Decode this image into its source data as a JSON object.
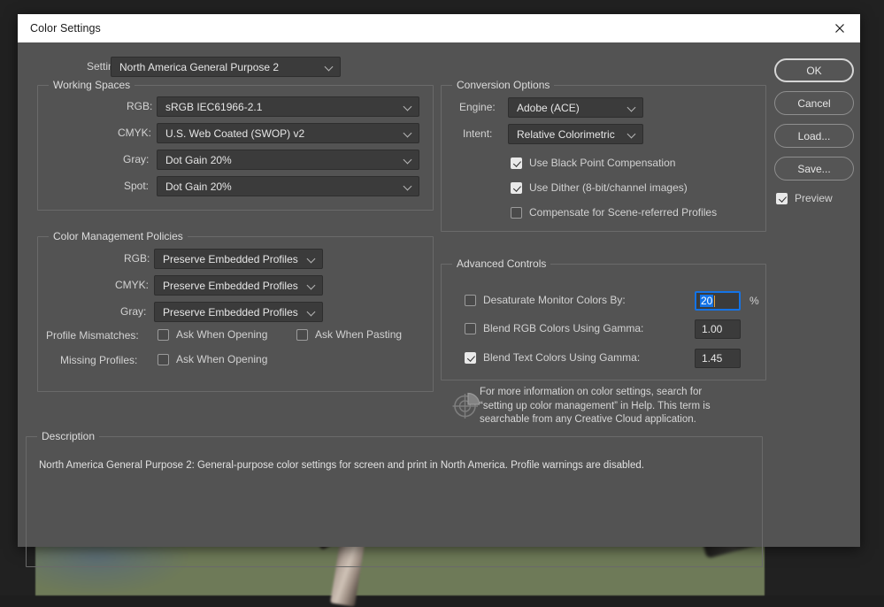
{
  "window": {
    "title": "Color Settings",
    "close_icon": "close-icon"
  },
  "settings_row": {
    "label": "Settings:",
    "value": "North America General Purpose 2"
  },
  "working_spaces": {
    "legend": "Working Spaces",
    "rows": [
      {
        "label": "RGB:",
        "value": "sRGB IEC61966-2.1"
      },
      {
        "label": "CMYK:",
        "value": "U.S. Web Coated (SWOP) v2"
      },
      {
        "label": "Gray:",
        "value": "Dot Gain 20%"
      },
      {
        "label": "Spot:",
        "value": "Dot Gain 20%"
      }
    ]
  },
  "color_management_policies": {
    "legend": "Color Management Policies",
    "rows": [
      {
        "label": "RGB:",
        "value": "Preserve Embedded Profiles"
      },
      {
        "label": "CMYK:",
        "value": "Preserve Embedded Profiles"
      },
      {
        "label": "Gray:",
        "value": "Preserve Embedded Profiles"
      }
    ],
    "profile_mismatches": {
      "label": "Profile Mismatches:",
      "ask_when_opening": "Ask When Opening",
      "ask_when_opening_checked": false,
      "ask_when_pasting": "Ask When Pasting",
      "ask_when_pasting_checked": false
    },
    "missing_profiles": {
      "label": "Missing Profiles:",
      "ask_when_opening": "Ask When Opening",
      "ask_when_opening_checked": false
    }
  },
  "conversion_options": {
    "legend": "Conversion Options",
    "engine": {
      "label": "Engine:",
      "value": "Adobe (ACE)"
    },
    "intent": {
      "label": "Intent:",
      "value": "Relative Colorimetric"
    },
    "checkboxes": [
      {
        "label": "Use Black Point Compensation",
        "checked": true
      },
      {
        "label": "Use Dither (8-bit/channel images)",
        "checked": true
      },
      {
        "label": "Compensate for Scene-referred Profiles",
        "checked": false
      }
    ]
  },
  "advanced_controls": {
    "legend": "Advanced Controls",
    "desaturate": {
      "label": "Desaturate Monitor Colors By:",
      "checked": false,
      "value": "20",
      "unit": "%",
      "focused": true
    },
    "blend_rgb": {
      "label": "Blend RGB Colors Using Gamma:",
      "checked": false,
      "value": "1.00"
    },
    "blend_text": {
      "label": "Blend Text Colors Using Gamma:",
      "checked": true,
      "value": "1.45"
    }
  },
  "help": {
    "icon": "color-wheel-icon",
    "line1": "For more information on color settings, search for",
    "line2": "“setting up color management” in Help. This term is",
    "line3": "searchable from any Creative Cloud application."
  },
  "description": {
    "legend": "Description",
    "text": "North America General Purpose 2:  General-purpose color settings for screen and print in North America. Profile warnings are disabled."
  },
  "buttons": {
    "ok": "OK",
    "cancel": "Cancel",
    "load": "Load...",
    "save": "Save...",
    "preview": "Preview",
    "preview_checked": true
  },
  "colors": {
    "dialog_bg": "#535353",
    "titlebar_bg": "#ffffff",
    "field_bg": "#3b3b3b",
    "accent_focus": "#1473e6",
    "text": "#e6e6e6"
  }
}
